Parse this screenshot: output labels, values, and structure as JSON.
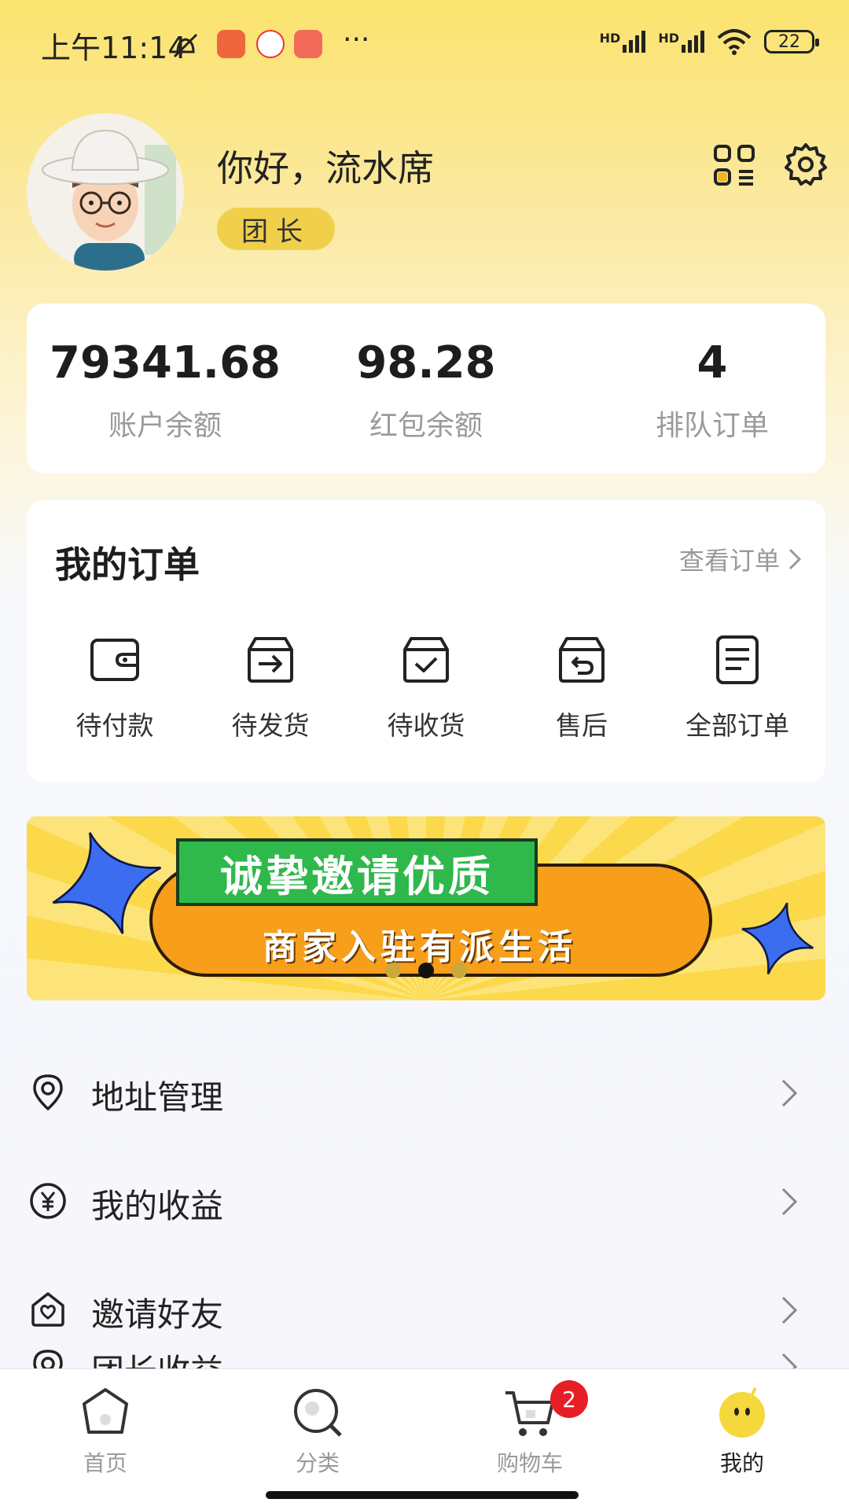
{
  "status_bar": {
    "time": "上午11:14",
    "battery": "22",
    "signal_label_1": "HD",
    "signal_label_2": "HD",
    "more": "···"
  },
  "profile": {
    "greeting": "你好，流水席",
    "role": "团长"
  },
  "stats": [
    {
      "value": "79341.68",
      "label": "账户余额"
    },
    {
      "value": "98.28",
      "label": "红包余额"
    },
    {
      "value": "4",
      "label": "排队订单"
    }
  ],
  "orders": {
    "title": "我的订单",
    "view_all": "查看订单",
    "items": [
      {
        "label": "待付款",
        "icon": "wallet-icon"
      },
      {
        "label": "待发货",
        "icon": "box-arrow-icon"
      },
      {
        "label": "待收货",
        "icon": "box-check-icon"
      },
      {
        "label": "售后",
        "icon": "box-return-icon"
      },
      {
        "label": "全部订单",
        "icon": "document-icon"
      }
    ]
  },
  "banner": {
    "headline": "诚挚邀请优质",
    "subline": "商家入驻有派生活",
    "slide_index": 2,
    "slide_count": 3
  },
  "menu": [
    {
      "label": "地址管理",
      "icon": "location-icon"
    },
    {
      "label": "我的收益",
      "icon": "yuan-icon"
    },
    {
      "label": "邀请好友",
      "icon": "heart-house-icon"
    },
    {
      "label": "团长收益",
      "icon": "location-icon"
    }
  ],
  "bottom_nav": {
    "items": [
      {
        "label": "首页",
        "icon": "home-icon"
      },
      {
        "label": "分类",
        "icon": "search-icon"
      },
      {
        "label": "购物车",
        "icon": "cart-icon"
      },
      {
        "label": "我的",
        "icon": "smiley-icon"
      }
    ],
    "active_index": 3,
    "cart_badge": "2"
  },
  "colors": {
    "accent_yellow": "#fbe36e",
    "badge_red": "#e81e25",
    "banner_orange": "#f79e1b",
    "banner_green": "#2fb84b"
  }
}
